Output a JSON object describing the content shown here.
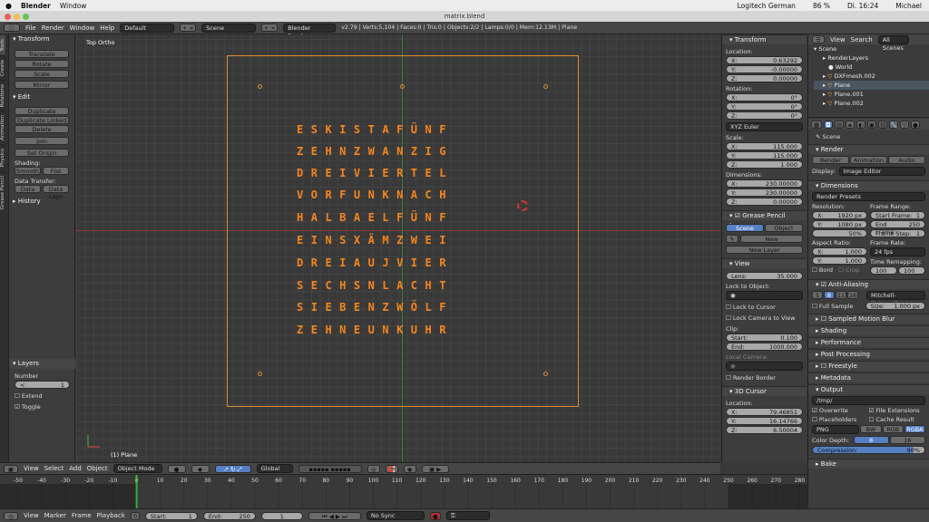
{
  "mac": {
    "apple": "",
    "app": "Blender",
    "window": "Window",
    "lang": "Logitech German",
    "battery": "86 %",
    "clock": "Di. 16:24",
    "user": "Michael"
  },
  "window_title": "matrix.blend",
  "info": {
    "menus": [
      "File",
      "Render",
      "Window",
      "Help"
    ],
    "layout": "Default",
    "scene": "Scene",
    "engine": "Blender Render",
    "stats": "v2.79 | Verts:5,104 | Faces:0 | Tris:0 | Objects:2/2 | Lamps:0/0 | Mem:12.13M | Plane"
  },
  "tabs": [
    "Tools",
    "Create",
    "Relations",
    "Animation",
    "Physics",
    "Grease Pencil"
  ],
  "tools": {
    "transform_header": "Transform",
    "translate": "Translate",
    "rotate": "Rotate",
    "scale": "Scale",
    "mirror": "Mirror",
    "edit_header": "Edit",
    "duplicate": "Duplicate",
    "duplicate_linked": "Duplicate Linked",
    "delete": "Delete",
    "join": "Join",
    "set_origin": "Set Origin",
    "shading_label": "Shading:",
    "smooth": "Smooth",
    "flat": "Flat",
    "data_transfer_label": "Data Transfer:",
    "data": "Data",
    "data_layo": "Data Layo",
    "history_header": "History",
    "layers_header": "Layers",
    "number_label": "Number",
    "number_value": "1",
    "extend": "Extend",
    "toggle": "Toggle"
  },
  "viewport": {
    "view_label": "Top Ortho",
    "object_label": "(1) Plane",
    "wordclock": [
      "ESKISTAFÜNF",
      "ZEHNZWANZIG",
      "DREIVIERTEL",
      "VORFUNKNACH",
      "HALBAELFÜNF",
      "EINSXÄMZWEI",
      "DREIAUJVIER",
      "SECHSNLACHT",
      "SIEBENZWÖLF",
      "ZEHNEUNKUHR"
    ]
  },
  "props": {
    "transform_header": "Transform",
    "location_label": "Location:",
    "loc": [
      {
        "a": "X:",
        "v": "0.63292"
      },
      {
        "a": "Y:",
        "v": "-0.00000"
      },
      {
        "a": "Z:",
        "v": "0.00000"
      }
    ],
    "rotation_label": "Rotation:",
    "rot": [
      {
        "a": "X:",
        "v": "0°"
      },
      {
        "a": "Y:",
        "v": "0°"
      },
      {
        "a": "Z:",
        "v": "0°"
      }
    ],
    "euler": "XYZ Euler",
    "scale_label": "Scale:",
    "scl": [
      {
        "a": "X:",
        "v": "115.000"
      },
      {
        "a": "Y:",
        "v": "115.000"
      },
      {
        "a": "Z:",
        "v": "1.000"
      }
    ],
    "dimensions_label": "Dimensions:",
    "dim": [
      {
        "a": "X:",
        "v": "230.00000"
      },
      {
        "a": "Y:",
        "v": "230.00000"
      },
      {
        "a": "Z:",
        "v": "0.00000"
      }
    ],
    "grease_header": "Grease Pencil Layers",
    "gp_scene": "Scene",
    "gp_object": "Object",
    "gp_new": "New",
    "gp_new_layer": "New Layer",
    "view_header": "View",
    "lens": "Lens:",
    "lens_value": "35.000",
    "lock_object": "Lock to Object:",
    "lock_cursor": "Lock to Cursor",
    "lock_camera": "Lock Camera to View",
    "clip_label": "Clip:",
    "clip_start": "Start:",
    "clip_start_v": "0.100",
    "clip_end": "End:",
    "clip_end_v": "1000.000",
    "local_camera": "Local Camera:",
    "render_border": "Render Border",
    "cursor_header": "3D Cursor",
    "cursor_location": "Location:",
    "cur": [
      {
        "a": "X:",
        "v": "79.46851"
      },
      {
        "a": "Y:",
        "v": "16.14766"
      },
      {
        "a": "Z:",
        "v": "6.50004"
      }
    ]
  },
  "outliner": {
    "view": "View",
    "search": "Search",
    "all_scenes": "All Scenes",
    "items": [
      "Scene",
      "RenderLayers",
      "World",
      "DXFmesh.002",
      "Plane",
      "Plane.001",
      "Plane.002"
    ]
  },
  "render": {
    "scene": "Scene",
    "render_header": "Render",
    "render_btn": "Render",
    "animation_btn": "Animation",
    "audio_btn": "Audio",
    "display_label": "Display:",
    "display": "Image Editor",
    "dimensions_header": "Dimensions",
    "presets": "Render Presets",
    "resolution": "Resolution:",
    "res_x": "1920 px",
    "res_y": "1080 px",
    "res_pct": "50%",
    "frame_range": "Frame Range:",
    "start_frame": "Start Frame:",
    "start_frame_v": "1",
    "end_frame": "End Frame:",
    "end_frame_v": "250",
    "frame_step": "Frame Step:",
    "frame_step_v": "1",
    "aspect": "Aspect Ratio:",
    "asp_x": "1.000",
    "asp_y": "1.000",
    "frame_rate": "Frame Rate:",
    "fps": "24 fps",
    "time_remap": "Time Remapping:",
    "remap_a": "100",
    "remap_b": "100",
    "bord": "Bord",
    "crop": "Crop",
    "aa_header": "Anti-Aliasing",
    "aa_vals": [
      "5",
      "8",
      "11",
      "16"
    ],
    "aa_filter": "Mitchell-Netravali",
    "full_sample": "Full Sample",
    "size_label": "Size:",
    "size_v": "1.000 px",
    "motion_blur": "Sampled Motion Blur",
    "shading": "Shading",
    "performance": "Performance",
    "post_processing": "Post Processing",
    "freestyle": "Freestyle",
    "metadata": "Metadata",
    "output_header": "Output",
    "output_path": "/tmp/",
    "overwrite": "Overwrite",
    "file_ext": "File Extensions",
    "placeholders": "Placeholders",
    "cache_result": "Cache Result",
    "format": "PNG",
    "bw": "BW",
    "rgb": "RGB",
    "rgba": "RGBA",
    "color_depth": "Color Depth:",
    "depth8": "8",
    "depth16": "16",
    "compression": "Compression:",
    "compression_v": "90%",
    "bake": "Bake"
  },
  "vheader": {
    "view": "View",
    "select": "Select",
    "add": "Add",
    "object": "Object",
    "mode": "Object Mode",
    "orientation": "Global"
  },
  "timeline": {
    "ticks": [
      "-50",
      "-40",
      "-30",
      "-20",
      "-10",
      "0",
      "10",
      "20",
      "30",
      "40",
      "50",
      "60",
      "70",
      "80",
      "90",
      "100",
      "110",
      "120",
      "130",
      "140",
      "150",
      "160",
      "170",
      "180",
      "190",
      "200",
      "210",
      "220",
      "230",
      "240",
      "250",
      "260",
      "270",
      "280"
    ],
    "current_frame": 0
  },
  "tlheader": {
    "view": "View",
    "marker": "Marker",
    "frame": "Frame",
    "playback": "Playback",
    "start": "Start:",
    "start_v": "1",
    "end": "End:",
    "end_v": "250",
    "current": "1",
    "sync": "No Sync"
  }
}
